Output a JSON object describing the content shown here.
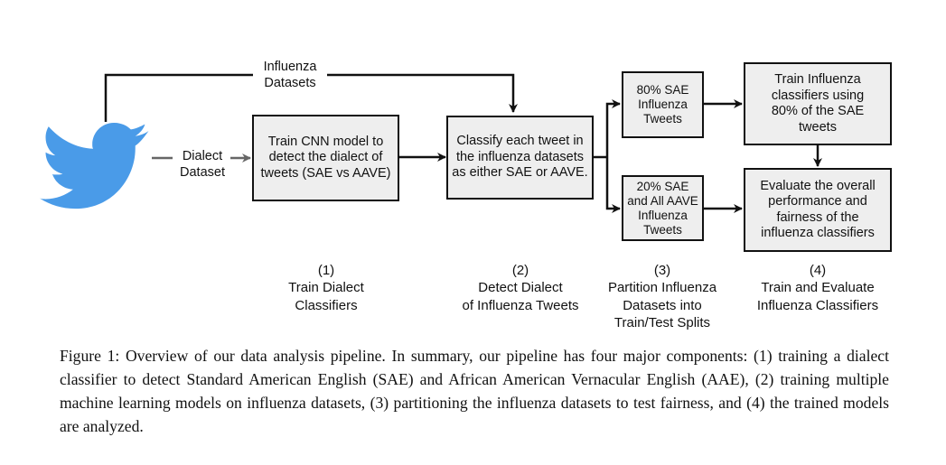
{
  "diagram": {
    "source_icon": "twitter-bird-icon",
    "colors": {
      "bird": "#4a9be8",
      "box_fill": "#eeeeee",
      "stroke": "#111111",
      "dialect_arrow": "#666666"
    },
    "edge_labels": {
      "influenza_datasets": "Influenza\nDatasets",
      "dialect_dataset": "Dialect\nDataset"
    },
    "boxes": {
      "train_cnn": "Train CNN model to\ndetect the dialect of\ntweets (SAE vs AAVE)",
      "classify": "Classify each tweet in\nthe influenza datasets\nas either SAE or AAVE.",
      "sae_80": "80% SAE\nInfluenza\nTweets",
      "sae_20_aave": "20% SAE\nand All AAVE\nInfluenza\nTweets",
      "train_influenza": "Train Influenza\nclassifiers using\n80% of the SAE\ntweets",
      "evaluate": "Evaluate the overall\nperformance and\nfairness of the\ninfluenza classifiers"
    },
    "stages": [
      {
        "number": "(1)",
        "label": "Train Dialect\nClassifiers"
      },
      {
        "number": "(2)",
        "label": "Detect Dialect\nof Influenza Tweets"
      },
      {
        "number": "(3)",
        "label": "Partition Influenza\nDatasets into\nTrain/Test Splits"
      },
      {
        "number": "(4)",
        "label": "Train and Evaluate\nInfluenza Classifiers"
      }
    ]
  },
  "caption": "Figure 1: Overview of our data analysis pipeline. In summary, our pipeline has four major components: (1) training a dialect classifier to detect Standard American English (SAE) and African American Vernacular English (AAE), (2) training multiple machine learning models on influenza datasets, (3) partitioning the influenza datasets to test fairness, and (4) the trained models are analyzed."
}
